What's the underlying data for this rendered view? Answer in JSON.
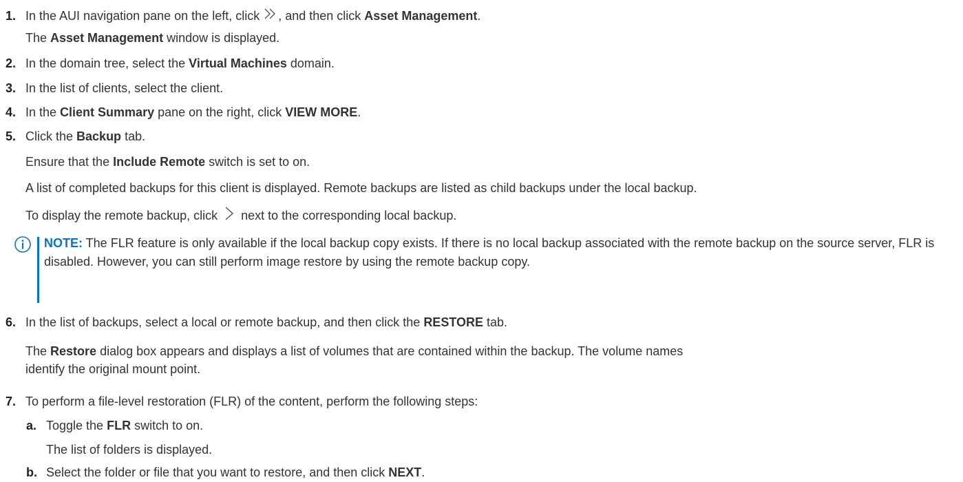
{
  "colors": {
    "accent": "#0672cb",
    "text": "#333333"
  },
  "steps": [
    {
      "num": "1.",
      "parts": [
        "In the AUI navigation pane on the left, click ",
        ", and then click ",
        "Asset Management",
        "."
      ],
      "line2": [
        "The ",
        "Asset Management",
        " window is displayed."
      ],
      "icon": "double-chevron-right-icon"
    },
    {
      "num": "2.",
      "parts": [
        "In the domain tree, select the ",
        "Virtual Machines",
        " domain."
      ]
    },
    {
      "num": "3.",
      "parts": [
        "In the list of clients, select the client."
      ]
    },
    {
      "num": "4.",
      "parts": [
        "In the ",
        "Client Summary",
        " pane on the right, click ",
        "VIEW MORE",
        "."
      ]
    },
    {
      "num": "5.",
      "parts": [
        "Click the ",
        "Backup",
        " tab."
      ],
      "p1": [
        "Ensure that the ",
        "Include Remote",
        " switch is set to on."
      ],
      "p2": "A list of completed backups for this client is displayed. Remote backups are listed as child backups under the local backup.",
      "p3": [
        "To display the remote backup, click ",
        " next to the corresponding local backup."
      ],
      "icon": "chevron-right-icon"
    },
    {
      "num": "6.",
      "parts": [
        "In the list of backups, select a local or remote backup, and then click the ",
        "RESTORE",
        " tab."
      ],
      "p1": [
        "The ",
        "Restore",
        " dialog box appears and displays a list of volumes that are contained within the backup. The volume names"
      ],
      "p1b": "identify the original mount point."
    },
    {
      "num": "7.",
      "parts": [
        "To perform a file-level restoration (FLR) of the content, perform the following steps:"
      ]
    }
  ],
  "note": {
    "label": "NOTE:",
    "text": " The FLR feature is only available if the local backup copy exists. If there is no local backup associated with the remote backup on the source server, FLR is disabled. However, you can still perform image restore by using the remote backup copy.",
    "icon": "info-icon"
  },
  "substeps": [
    {
      "num": "a.",
      "parts": [
        "Toggle the ",
        "FLR",
        " switch to on."
      ],
      "p1": "The list of folders is displayed."
    },
    {
      "num": "b.",
      "parts": [
        "Select the folder or file that you want to restore, and then click ",
        "NEXT",
        "."
      ]
    }
  ]
}
